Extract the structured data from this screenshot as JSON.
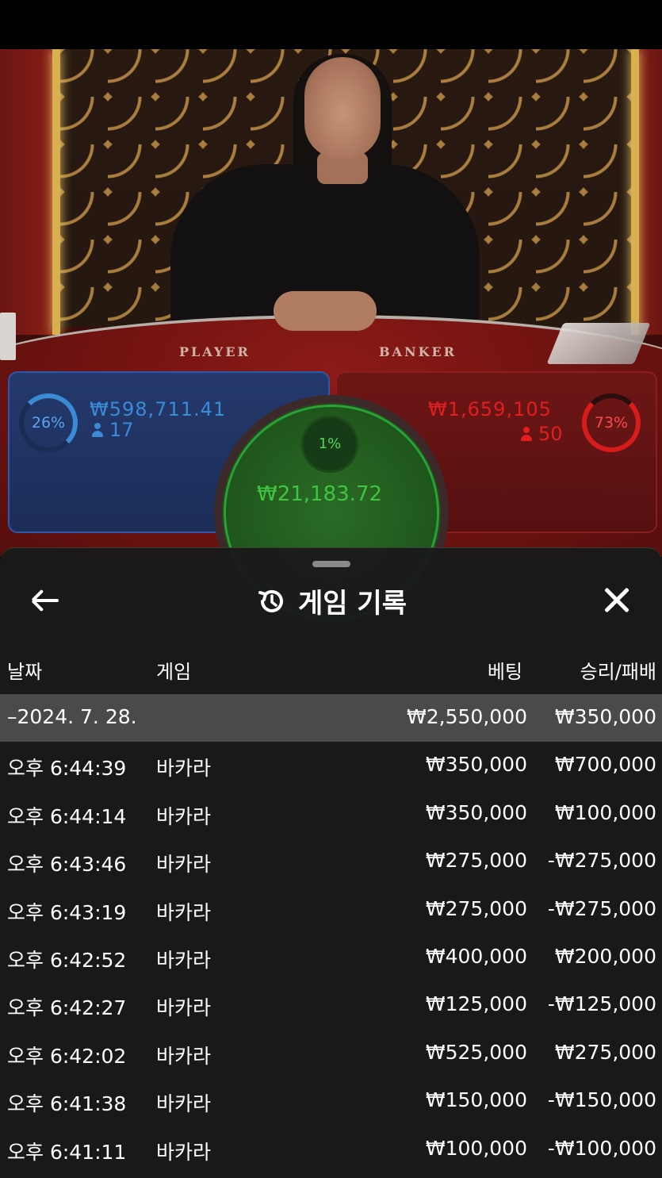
{
  "table": {
    "player_label": "PLAYER",
    "banker_label": "BANKER",
    "player": {
      "percent": "26%",
      "amount": "₩598,711.41",
      "count": "17"
    },
    "banker": {
      "percent": "73%",
      "amount": "₩1,659,105",
      "count": "50"
    },
    "tie": {
      "percent": "1%",
      "amount": "₩21,183.72"
    }
  },
  "sheet": {
    "title": "게임 기록",
    "columns": {
      "date": "날짜",
      "game": "게임",
      "bet": "베팅",
      "winloss": "승리/패배"
    },
    "date_group": {
      "date": "–2024. 7. 28.",
      "bet": "₩2,550,000",
      "winloss": "₩350,000"
    },
    "rows": [
      {
        "time": "오후 6:44:39",
        "game": "바카라",
        "bet": "₩350,000",
        "winloss": "₩700,000"
      },
      {
        "time": "오후 6:44:14",
        "game": "바카라",
        "bet": "₩350,000",
        "winloss": "₩100,000"
      },
      {
        "time": "오후 6:43:46",
        "game": "바카라",
        "bet": "₩275,000",
        "winloss": "-₩275,000"
      },
      {
        "time": "오후 6:43:19",
        "game": "바카라",
        "bet": "₩275,000",
        "winloss": "-₩275,000"
      },
      {
        "time": "오후 6:42:52",
        "game": "바카라",
        "bet": "₩400,000",
        "winloss": "₩200,000"
      },
      {
        "time": "오후 6:42:27",
        "game": "바카라",
        "bet": "₩125,000",
        "winloss": "-₩125,000"
      },
      {
        "time": "오후 6:42:02",
        "game": "바카라",
        "bet": "₩525,000",
        "winloss": "₩275,000"
      },
      {
        "time": "오후 6:41:38",
        "game": "바카라",
        "bet": "₩150,000",
        "winloss": "-₩150,000"
      },
      {
        "time": "오후 6:41:11",
        "game": "바카라",
        "bet": "₩100,000",
        "winloss": "-₩100,000"
      }
    ]
  },
  "icons": {
    "back": "arrow-left-icon",
    "history": "history-icon",
    "close": "close-icon",
    "person": "person-icon"
  },
  "colors": {
    "player": "#3a8ad6",
    "banker": "#e21e1e",
    "tie": "#3ec43e",
    "sheet_bg": "#1a1a1a",
    "date_row_bg": "#4a4a4a"
  }
}
